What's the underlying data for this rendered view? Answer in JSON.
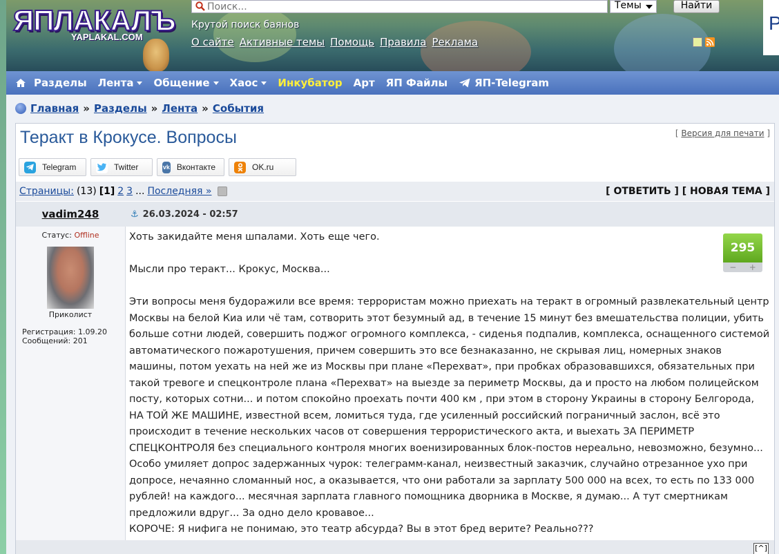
{
  "header": {
    "logo_text": "ЯПЛАКАЛЪ",
    "logo_sub": "YAPLAKAL.COM",
    "search_placeholder": "Поиск...",
    "search_scope": "Темы",
    "search_button": "Найти",
    "tagline": "Крутой поиск баянов",
    "links": [
      "О сайте",
      "Активные темы",
      "Помощь",
      "Правила",
      "Реклама"
    ],
    "right_letter": "Р"
  },
  "nav": {
    "items": [
      {
        "label": "Разделы",
        "dropdown": false
      },
      {
        "label": "Лента",
        "dropdown": true
      },
      {
        "label": "Общение",
        "dropdown": true
      },
      {
        "label": "Хаос",
        "dropdown": true
      },
      {
        "label": "Инкубатор",
        "dropdown": false,
        "highlight": "#ffef3a"
      },
      {
        "label": "Арт",
        "dropdown": false
      },
      {
        "label": "ЯП Файлы",
        "dropdown": false
      },
      {
        "label": "ЯП-Telegram",
        "dropdown": false
      }
    ]
  },
  "breadcrumb": [
    "Главная",
    "Разделы",
    "Лента",
    "События"
  ],
  "breadcrumb_sep": "»",
  "topic": {
    "title": "Теракт в Крокусе. Вопросы",
    "print_link": "Версия для печати"
  },
  "share": [
    "Telegram",
    "Twitter",
    "Вконтакте",
    "OK.ru"
  ],
  "pagination": {
    "label": "Страницы:",
    "count": "(13)",
    "current": "[1]",
    "pages": [
      "2",
      "3"
    ],
    "ellipsis": "...",
    "last": "Последняя »"
  },
  "actions": {
    "reply": "ОТВЕТИТЬ",
    "new_topic": "НОВАЯ ТЕМА"
  },
  "post": {
    "author": "vadim248",
    "date": "26.03.2024 - 02:57",
    "status_label": "Статус:",
    "status_value": "Offline",
    "rank": "Приколист",
    "registration": "Регистрация: 1.09.20",
    "messages": "Сообщений: 201",
    "rating": "295",
    "rating_minus": "−",
    "rating_plus": "+",
    "lines": [
      "Хоть закидайте меня шпалами. Хоть еще чего.",
      "",
      "Мысли про теракт... Крокус, Москва...",
      "",
      "Эти вопросы меня будоражили все время: террористам можно приехать на теракт в огромный развлекательный центр Москвы на белой Киа или чё там, сотворить этот безумный ад, в течение 15 минут без вмешательства полиции, убить больше сотни людей, совершить поджог огромного комплекса, - сиденья подпалив, комплекса, оснащенного системой автоматического пожаротушения, причем совершить это все безнаказанно, не скрывая лиц, номерных знаков машины, потом уехать на ней же из Москвы при плане «Перехват», при пробках образовавшихся, обязательных при такой тревоге и спецконтроле плана «Перехват» на выезде за периметр Москвы, да и просто на любом полицейском посту, которых сотни... и потом спокойно проехать почти 400 км , при этом в сторону Украины в сторону Белгорода, НА ТОЙ ЖЕ МАШИНЕ, известной всем, ломиться туда, где усиленный российский пограничный заслон, всё это происходит в течение нескольких часов от совершения террористического акта, и выехать ЗА ПЕРИМЕТР СПЕЦКОНТРОЛЯ без специального контроля многих военизированных блок-постов нереально, невозможно, безумно... Особо умиляет допрос задержанных чурок: телеграмм-канал, неизвестный заказчик, случайно отрезанное ухо при допросе, нечаянно сломанный нос, а оказывается, что они работали за зарплату 500 000 на всех, то есть по 133 000 рублей! на каждого... месячная зарплата главного помощника дворника в Москве, я думаю... А тут смертникам предложили вдруг... За одно дело кровавое...",
      "КОРОЧЕ: Я нифига не понимаю, это театр абсурда? Вы в этот бред верите? Реально???"
    ]
  },
  "to_top": "[^]",
  "colors": {
    "nav_bg": "#4a72bd",
    "link": "#1a4a9a",
    "title": "#2a5a9a",
    "rating": "#5fa81f",
    "offline": "#b03020"
  }
}
